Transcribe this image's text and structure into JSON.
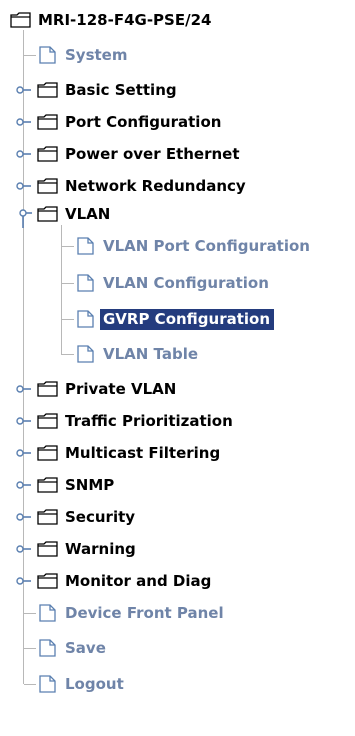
{
  "tree": {
    "root_label": "MRI-128-F4G-PSE/24",
    "items": [
      {
        "label": "System",
        "type": "page"
      },
      {
        "label": "Basic Setting",
        "type": "folder"
      },
      {
        "label": "Port Configuration",
        "type": "folder"
      },
      {
        "label": "Power over Ethernet",
        "type": "folder"
      },
      {
        "label": "Network Redundancy",
        "type": "folder"
      },
      {
        "label": "VLAN",
        "type": "folder",
        "expanded": true,
        "children": [
          {
            "label": "VLAN Port Configuration",
            "type": "page"
          },
          {
            "label": "VLAN Configuration",
            "type": "page"
          },
          {
            "label": "GVRP Configuration",
            "type": "page",
            "selected": true
          },
          {
            "label": "VLAN Table",
            "type": "page"
          }
        ]
      },
      {
        "label": "Private VLAN",
        "type": "folder"
      },
      {
        "label": "Traffic Prioritization",
        "type": "folder"
      },
      {
        "label": "Multicast Filtering",
        "type": "folder"
      },
      {
        "label": "SNMP",
        "type": "folder"
      },
      {
        "label": "Security",
        "type": "folder"
      },
      {
        "label": "Warning",
        "type": "folder"
      },
      {
        "label": "Monitor and Diag",
        "type": "folder"
      },
      {
        "label": "Device Front Panel",
        "type": "page"
      },
      {
        "label": "Save",
        "type": "page"
      },
      {
        "label": "Logout",
        "type": "page"
      }
    ]
  },
  "colors": {
    "folder_text": "#000000",
    "page_link_text": "#6f84a8",
    "selected_bg": "#243c7e",
    "selected_text": "#ffffff",
    "tree_line": "#b8b8b8",
    "handle": "#5a7fb0"
  },
  "icons": {
    "folder": "folder-icon",
    "page": "page-icon",
    "expand_handle": "expand-handle-icon"
  }
}
